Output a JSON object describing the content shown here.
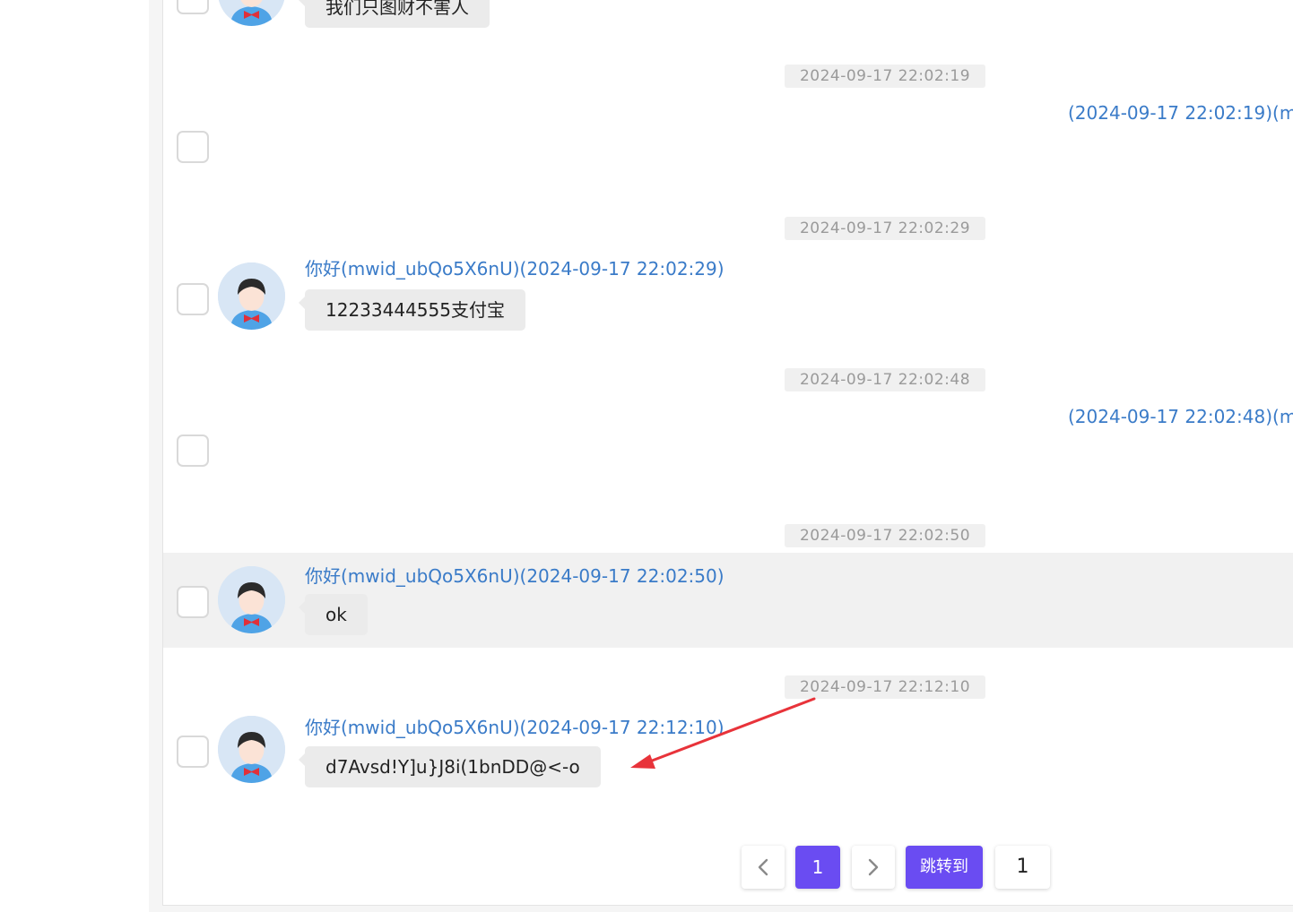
{
  "messages": [
    {
      "text": "我们只图财不害人"
    },
    {
      "time": "2024-09-17 22:02:19",
      "right_sender": "(2024-09-17 22:02:19)(mw"
    },
    {
      "time": "2024-09-17 22:02:29",
      "sender": "你好(mwid_ubQo5X6nU)(2024-09-17 22:02:29)",
      "text": "12233444555支付宝"
    },
    {
      "time": "2024-09-17 22:02:48",
      "right_sender": "(2024-09-17 22:02:48)(mw"
    },
    {
      "time": "2024-09-17 22:02:50",
      "sender": "你好(mwid_ubQo5X6nU)(2024-09-17 22:02:50)",
      "text": "ok"
    },
    {
      "time": "2024-09-17 22:12:10",
      "sender": "你好(mwid_ubQo5X6nU)(2024-09-17 22:12:10)",
      "text": "d7Avsd!Y]u}J8i(1bnDD@<-o"
    }
  ],
  "pagination": {
    "prev_icon": "chevron-left-icon",
    "current_page": "1",
    "next_icon": "chevron-right-icon",
    "jump_label": "跳转到",
    "jump_input_value": "1"
  },
  "colors": {
    "accent": "#6a4cf2",
    "sender_link": "#3a7bc8",
    "annotation_arrow": "#e8333a"
  }
}
